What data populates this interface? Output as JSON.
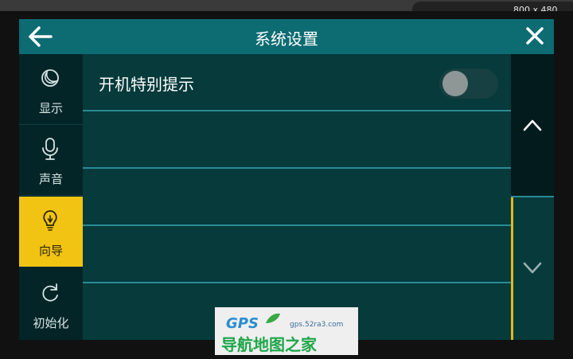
{
  "resolution_label": "800 x 480",
  "header": {
    "title": "系统设置"
  },
  "sidebar": {
    "items": [
      {
        "label": "显示",
        "icon": "moon-icon",
        "active": false
      },
      {
        "label": "声音",
        "icon": "microphone-icon",
        "active": false
      },
      {
        "label": "向导",
        "icon": "lightbulb-icon",
        "active": true
      },
      {
        "label": "初始化",
        "icon": "refresh-icon",
        "active": false
      }
    ]
  },
  "settings": {
    "rows": [
      {
        "label": "开机特别提示",
        "toggle_on": false
      }
    ]
  },
  "watermark": {
    "brand": "GPS",
    "url": "gps.52ra3.com",
    "name": "导航地图之家"
  },
  "colors": {
    "header": "#0d6b72",
    "active": "#f1c413",
    "background": "#063a3b",
    "accent_line": "#2b8a95"
  }
}
